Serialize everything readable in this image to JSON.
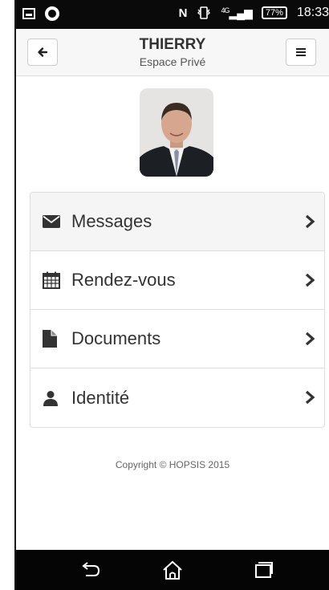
{
  "status_bar": {
    "time": "18:33",
    "battery": "77%",
    "network": "4G"
  },
  "header": {
    "title": "THIERRY",
    "subtitle": "Espace Privé",
    "back_icon": "arrow-left-icon",
    "menu_icon": "hamburger-menu-icon"
  },
  "menu": {
    "items": [
      {
        "label": "Messages",
        "icon": "envelope-icon"
      },
      {
        "label": "Rendez-vous",
        "icon": "calendar-icon"
      },
      {
        "label": "Documents",
        "icon": "document-icon"
      },
      {
        "label": "Identité",
        "icon": "user-icon"
      }
    ]
  },
  "footer": {
    "copyright": "Copyright © HOPSIS 2015"
  },
  "colors": {
    "text": "#333333",
    "border": "#dddddd",
    "highlight": "#f5f5f5"
  }
}
